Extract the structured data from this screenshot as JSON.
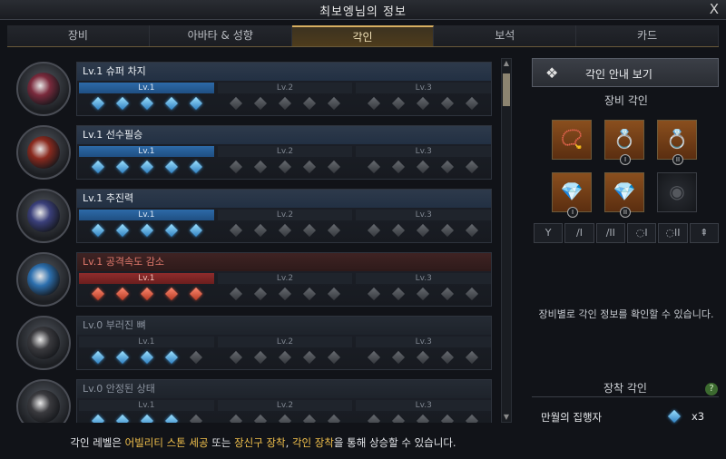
{
  "window": {
    "title": "최보엥님의 정보",
    "close_glyph": "X"
  },
  "tabs": [
    {
      "label": "장비",
      "active": false
    },
    {
      "label": "아바타 & 성향",
      "active": false
    },
    {
      "label": "각인",
      "active": true
    },
    {
      "label": "보석",
      "active": false
    },
    {
      "label": "카드",
      "active": false
    }
  ],
  "engravings": [
    {
      "name": "Lv.1 슈퍼 차지",
      "state": "normal",
      "bars": [
        "Lv.1",
        "Lv.2",
        "Lv.3"
      ],
      "active_bars": 1,
      "active_gems": 5,
      "portrait_color": "#7a2a3c"
    },
    {
      "name": "Lv.1 선수필승",
      "state": "normal",
      "bars": [
        "Lv.1",
        "Lv.2",
        "Lv.3"
      ],
      "active_bars": 1,
      "active_gems": 5,
      "portrait_color": "#8a2a1e"
    },
    {
      "name": "Lv.1 추진력",
      "state": "normal",
      "bars": [
        "Lv.1",
        "Lv.2",
        "Lv.3"
      ],
      "active_bars": 1,
      "active_gems": 5,
      "portrait_color": "#3a3f7a"
    },
    {
      "name": "Lv.1 공격속도 감소",
      "state": "penalty",
      "bars": [
        "Lv.1",
        "Lv.2",
        "Lv.3"
      ],
      "active_bars": 1,
      "active_gems": 5,
      "portrait_color": "#2c6fae"
    },
    {
      "name": "Lv.0 부러진 뼈",
      "state": "inactive",
      "bars": [
        "Lv.1",
        "Lv.2",
        "Lv.3"
      ],
      "active_bars": 0,
      "active_gems": 4,
      "portrait_color": "#3a3a3e"
    },
    {
      "name": "Lv.0 안정된 상태",
      "state": "inactive",
      "bars": [
        "Lv.1",
        "Lv.2",
        "Lv.3"
      ],
      "active_bars": 0,
      "active_gems": 4,
      "portrait_color": "#3a3a3e"
    }
  ],
  "footer": {
    "pre": "각인 레벨은 ",
    "hl1": "어빌리티 스톤 세공",
    "mid1": " 또는 ",
    "hl2": "장신구 장착",
    "mid2": ", ",
    "hl3": "각인 장착",
    "post": "을 통해 상승할 수 있습니다."
  },
  "side": {
    "guide_button": "각인 안내 보기",
    "equip_title": "장비 각인",
    "equip_badges": [
      "",
      "I",
      "II",
      "I",
      "II",
      ""
    ],
    "slot_labels": [
      "Y",
      "∕I",
      "∕II",
      "◌I",
      "◌II",
      "⇞"
    ],
    "info_text": "장비별로 각인 정보를 확인할 수 있습니다.",
    "apply_title": "장착 각인",
    "help_glyph": "?",
    "apply_name": "만월의 집행자",
    "apply_count": "x3"
  }
}
